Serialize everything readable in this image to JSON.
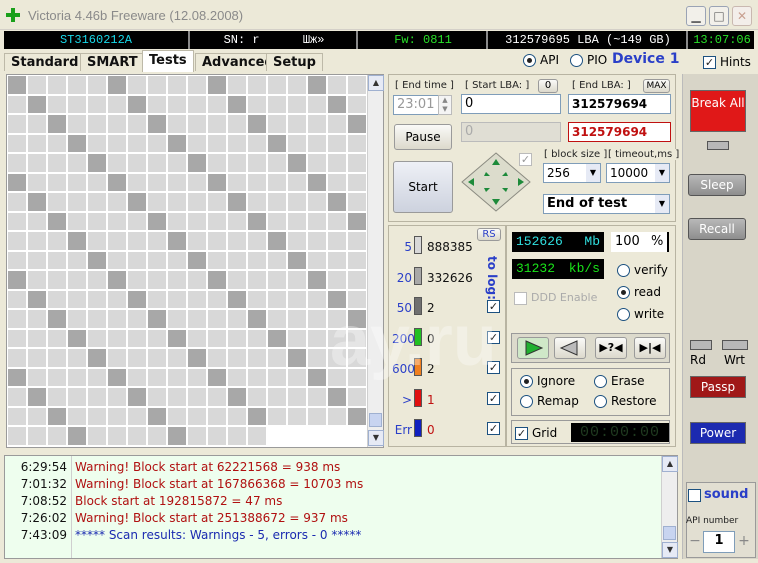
{
  "window": {
    "title": "Victoria 4.46b Freeware (12.08.2008)"
  },
  "infobar": {
    "model": "ST3160212A",
    "serial": "SN: r",
    "serial_extra": "Шж»",
    "firmware": "Fw: 0811",
    "lba_capacity": "312579695 LBA (~149 GB)",
    "clock": "13:07:06"
  },
  "tabs": [
    "Standard",
    "SMART",
    "Tests",
    "Advanced",
    "Setup"
  ],
  "mode": {
    "api_label": "API",
    "pio_label": "PIO",
    "device_label": "Device 1",
    "hints_label": "Hints"
  },
  "scan": {
    "end_time_label": "[ End time ]",
    "end_time_value": "23:01",
    "start_lba_label": "[ Start LBA: ]",
    "start_lba_btn": "0",
    "start_lba_value": "0",
    "start_lba_current": "0",
    "end_lba_label": "[ End LBA: ]",
    "end_lba_btn": "MAX",
    "end_lba_value": "312579694",
    "end_lba_current": "312579694",
    "pause_label": "Pause",
    "start_label": "Start",
    "block_size_label": "[ block size ]",
    "block_size_value": "256",
    "timeout_label": "[ timeout,ms ]",
    "timeout_value": "10000",
    "end_action": "End of test"
  },
  "stats": {
    "rs_label": "RS",
    "to_log_label": "to log:",
    "rows": [
      {
        "label": "5",
        "count": "888385",
        "color": "#d8d8d8"
      },
      {
        "label": "20",
        "count": "332626",
        "color": "#a8a8a8"
      },
      {
        "label": "50",
        "count": "2",
        "color": "#707070"
      },
      {
        "label": "200",
        "count": "0",
        "color": "#22c022"
      },
      {
        "label": "600",
        "count": "2",
        "color": "#f08020"
      },
      {
        "label": ">",
        "count": "1",
        "color": "#e01010"
      },
      {
        "label": "Err",
        "count": "0",
        "color": "#1020c0"
      }
    ]
  },
  "progress": {
    "mb_value": "152626",
    "mb_unit": "Mb",
    "percent_value": "100",
    "percent_unit": "%",
    "speed_value": "31232",
    "speed_unit": "kb/s",
    "ddd_label": "DDD Enable",
    "verify_label": "verify",
    "read_label": "read",
    "write_label": "write",
    "ignore_label": "Ignore",
    "erase_label": "Erase",
    "remap_label": "Remap",
    "restore_label": "Restore",
    "grid_label": "Grid",
    "timer": "00:00:00"
  },
  "side": {
    "break_label": "Break All",
    "sleep_label": "Sleep",
    "recall_label": "Recall",
    "rd_label": "Rd",
    "wrt_label": "Wrt",
    "passp_label": "Passp",
    "power_label": "Power",
    "sound_label": "sound",
    "api_number_label": "API number",
    "api_number_value": "1",
    "minus": "−",
    "plus": "+"
  },
  "log": [
    {
      "time": "6:29:54",
      "message": "Warning! Block start at 62221568 = 938 ms",
      "color": "#b01010"
    },
    {
      "time": "7:01:32",
      "message": "Warning! Block start at 167866368 = 10703 ms",
      "color": "#b01010"
    },
    {
      "time": "7:08:52",
      "message": "Block start at 192815872 = 47 ms",
      "color": "#b01010"
    },
    {
      "time": "7:26:02",
      "message": "Warning! Block start at 251388672 = 937 ms",
      "color": "#b01010"
    },
    {
      "time": "7:43:09",
      "message": "***** Scan results: Warnings - 5, errors - 0 *****",
      "color": "#1a2ab0"
    }
  ],
  "watermark": "ay.ru"
}
